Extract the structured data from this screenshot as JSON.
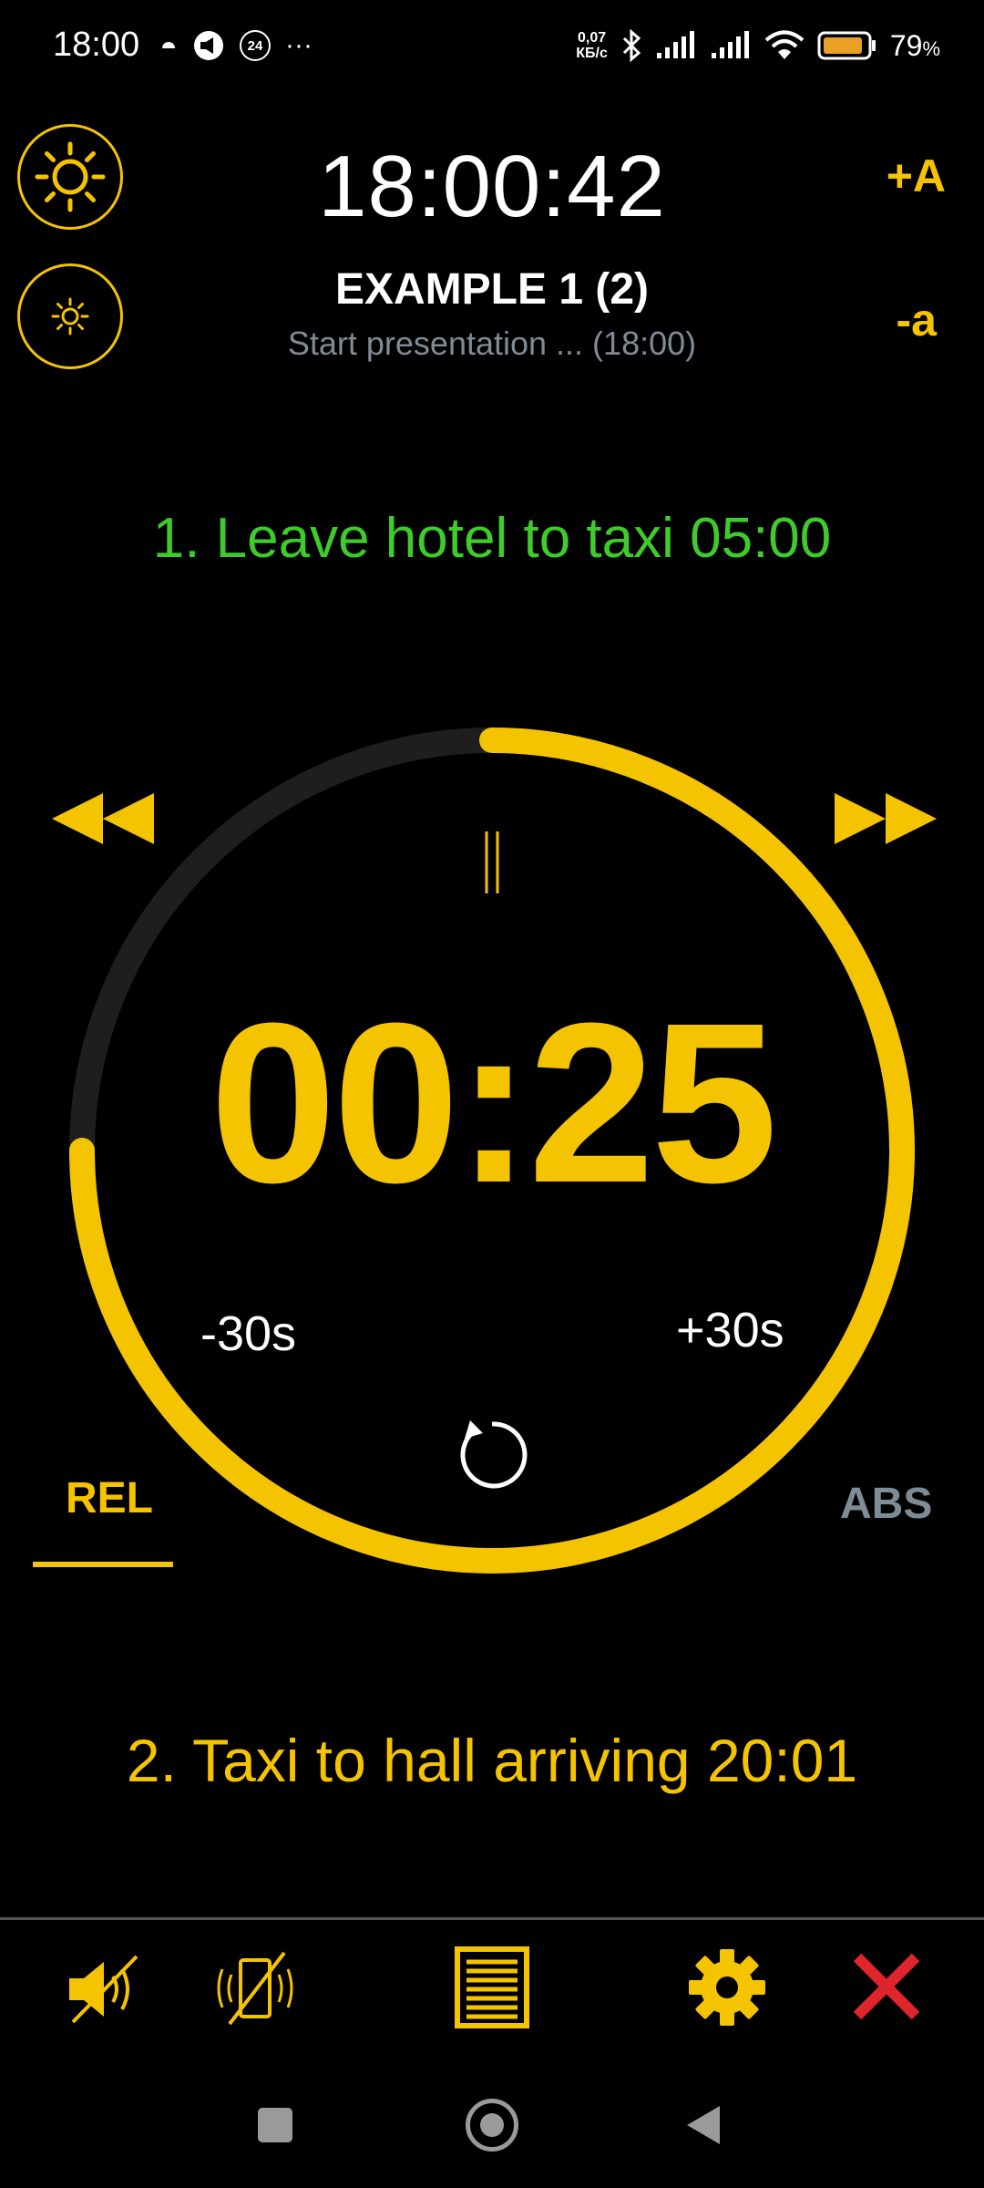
{
  "status_bar": {
    "time": "18:00",
    "notif_badge": "24",
    "more": "···",
    "net_speed_value": "0,07",
    "net_speed_unit": "КБ/с",
    "battery_percent": "79",
    "battery_suffix": "%"
  },
  "header": {
    "clock": "18:00:42",
    "title": "EXAMPLE 1 (2)",
    "subtitle": "Start presentation ... (18:00)",
    "font_increase_label": "+A",
    "font_decrease_label": "-a"
  },
  "current_step": "1. Leave hotel to taxi  05:00",
  "timer": {
    "countdown": "00:25",
    "minus_label": "-30s",
    "plus_label": "+30s",
    "progress_fraction": 0.75
  },
  "tabs": {
    "rel": "REL",
    "abs": "ABS"
  },
  "next_step": "2. Taxi to hall arriving 20:01",
  "colors": {
    "accent": "#f5c400",
    "current_step": "#3ecb2b",
    "muted": "#7f8c95",
    "close": "#e0242b",
    "track": "#1e1e1e"
  },
  "icons": {
    "brightness_up": "sun-large-icon",
    "brightness_down": "sun-small-icon",
    "rewind": "rewind-icon",
    "fast_forward": "fast-forward-icon",
    "pause": "pause-icon",
    "reset": "reset-icon",
    "sound_off": "speaker-muted-icon",
    "vibrate_off": "vibrate-off-icon",
    "list": "list-icon",
    "settings": "gear-icon",
    "close": "close-icon"
  }
}
